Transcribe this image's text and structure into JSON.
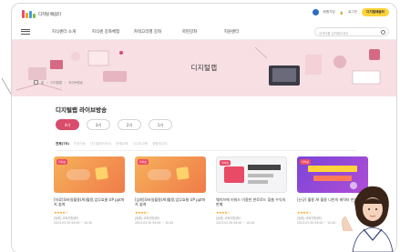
{
  "header": {
    "logo_text": "디지털 배움터",
    "util_links": [
      "회원가입",
      "로그인"
    ],
    "util_pill": "디지털배움터"
  },
  "gnb": {
    "menu": [
      "지식센터 소개",
      "지식센 강좌체험",
      "카테고리별 강좌",
      "북펀강좌",
      "지원센터"
    ],
    "search_placeholder": "검색어를 입력해주세요"
  },
  "hero": {
    "title": "디지털랩"
  },
  "breadcrumb": [
    "홈",
    "디지털랩",
    "라이브방송"
  ],
  "section": {
    "title": "디지털랩 라이브방송",
    "tabs": [
      {
        "label": "4기",
        "active": true
      },
      {
        "label": "3기",
        "active": false
      },
      {
        "label": "2기",
        "active": false
      },
      {
        "label": "1기",
        "active": false
      }
    ],
    "filters": [
      "전체(75)",
      "인공지능",
      "디지털리터러시",
      "문해교육",
      "시니어교육",
      "생활미디어"
    ]
  },
  "cards": [
    {
      "badge": "라이브",
      "title": "[자료]모바일활용(AI)활용,업무효율 UP ppt까지 쉽게",
      "rating": "★★★★☆",
      "meta1": "[등록] 교육지원센터",
      "meta2": "2023.03.30 09:00 ~ 10:40"
    },
    {
      "badge": "라이브",
      "title": "[심화]모바일활용(AI)활용,업무효율 UP ppt까지 쉽게",
      "rating": "★★★★☆",
      "meta1": "[등록] 교육지원센터",
      "meta2": "2023.03.30 09:00 ~ 10:40"
    },
    {
      "badge": "라이브",
      "title": "웨이브에 키워드 이용한 판로로드 맞춤 수익의 판매",
      "rating": "★★★★☆",
      "meta1": "[등록] 교육지원센터",
      "meta2": "2023.03.30 09:00 ~ 10:40"
    },
    {
      "badge": "라이브",
      "title": "[신규] 활용 AI 활용 나만의 캐릭터 만들기",
      "rating": "★★★★☆",
      "meta1": "[등록] 교육지원센터",
      "meta2": "2023.03.30 09:00 ~ 10:40"
    }
  ],
  "colors": {
    "accent": "#d94c6b",
    "hero_bg": "#f7dfe4",
    "search_pill": "#ffd43b"
  }
}
